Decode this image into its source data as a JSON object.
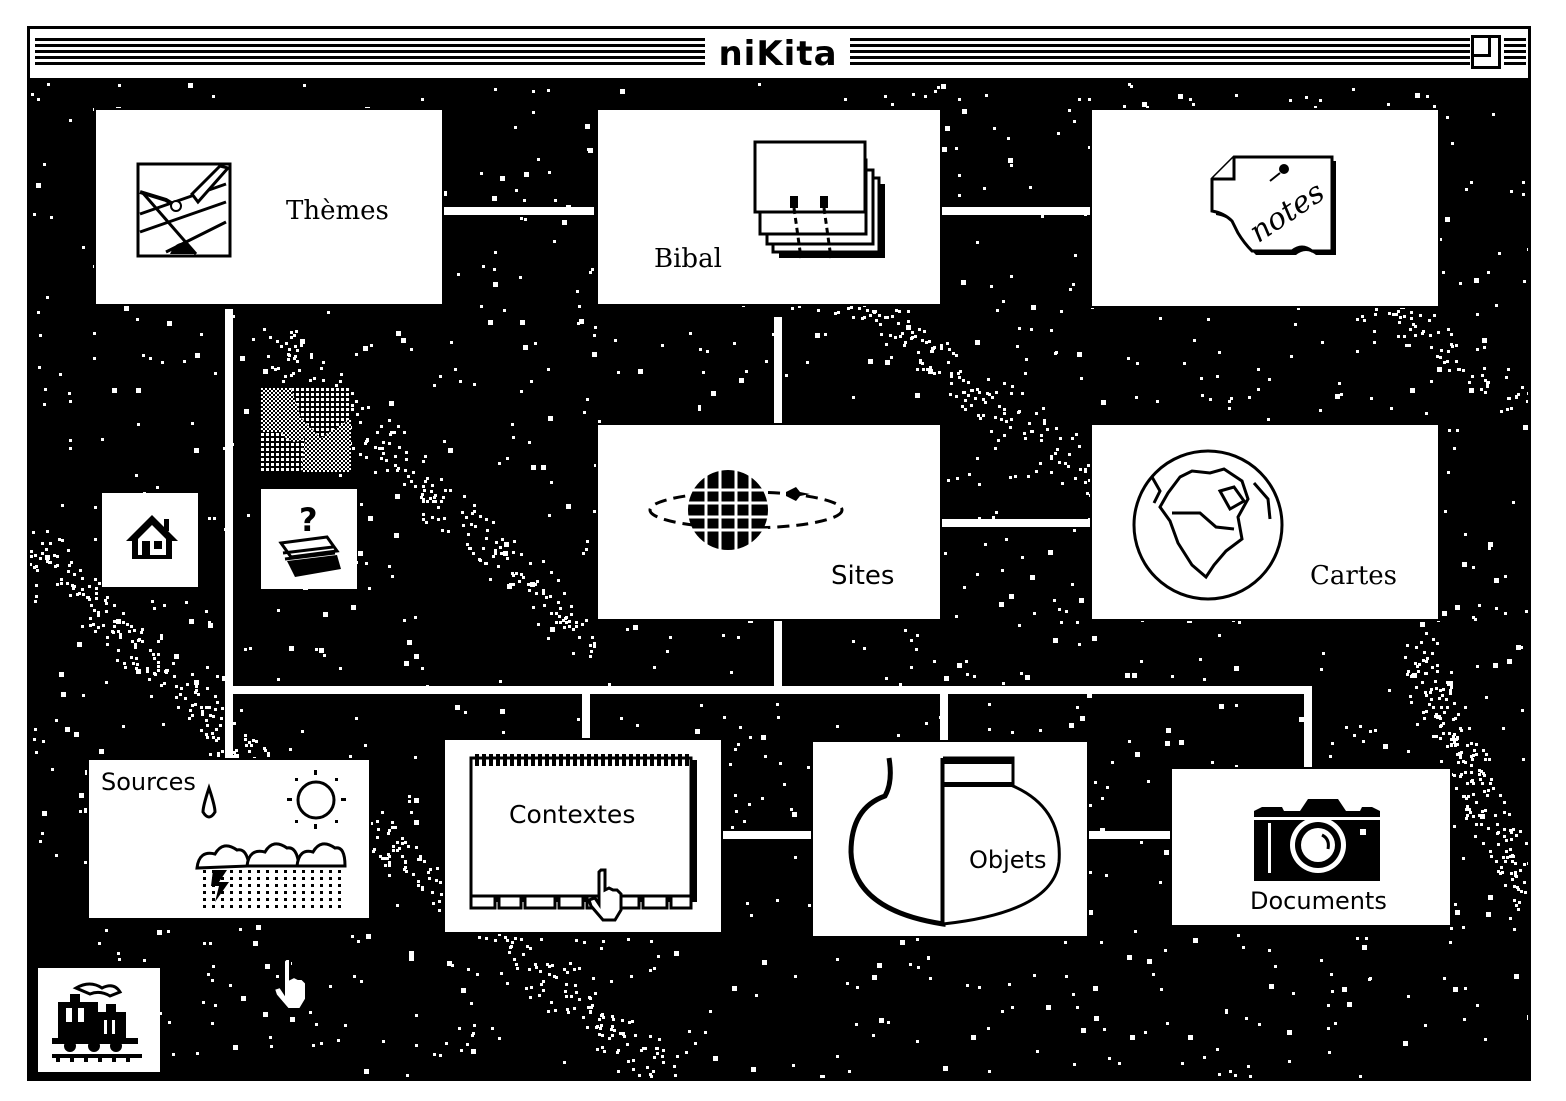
{
  "window": {
    "title": "niKita",
    "zoom_box_icon": "zoom-box-icon"
  },
  "modules": {
    "themes": {
      "label": "Thèmes",
      "icon": "drawing-pen-icon"
    },
    "bibal": {
      "label": "Bibal",
      "icon": "card-file-icon"
    },
    "notes": {
      "label": "",
      "icon": "notes-paper-icon",
      "icon_text": "notes"
    },
    "sites": {
      "label": "Sites",
      "icon": "globe-orbit-plane-icon"
    },
    "cartes": {
      "label": "Cartes",
      "icon": "world-globe-map-icon"
    },
    "sources": {
      "label": "Sources",
      "icon": "weather-sun-cloud-rain-icon"
    },
    "contextes": {
      "label": "Contextes",
      "icon": "index-tabs-notebook-icon"
    },
    "objets": {
      "label": "Objets",
      "icon": "pottery-jar-icon"
    },
    "documents": {
      "label": "Documents",
      "icon": "camera-icon"
    }
  },
  "tools": {
    "home": {
      "icon": "home-icon"
    },
    "help": {
      "icon": "help-question-stack-icon"
    },
    "puzzle": {
      "icon": "puzzle-pattern-icon"
    },
    "train": {
      "icon": "steam-train-icon"
    }
  },
  "cursors": {
    "pointer_hand": "hand-pointer-icon"
  }
}
